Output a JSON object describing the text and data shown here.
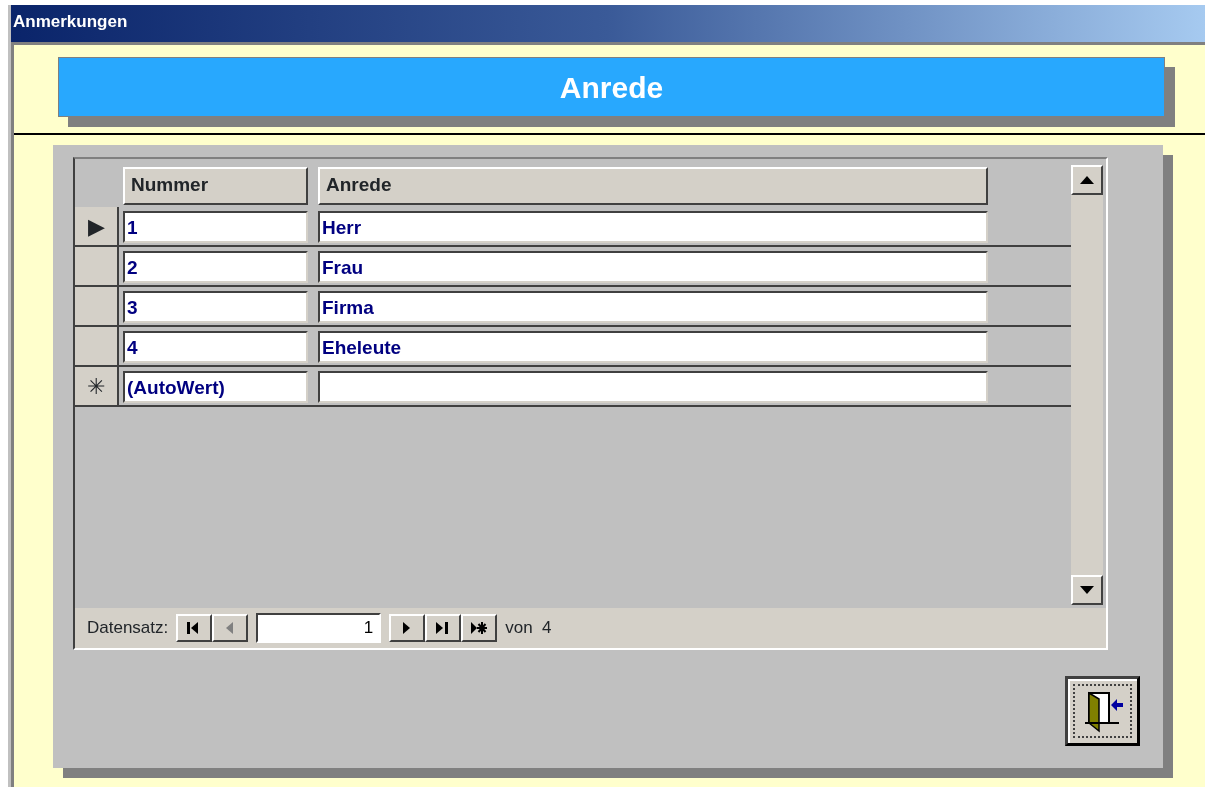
{
  "window": {
    "title": "Anmerkungen"
  },
  "header": {
    "title": "Anrede"
  },
  "table": {
    "columns": [
      "Nummer",
      "Anrede"
    ],
    "rows": [
      {
        "selector": "▶",
        "cells": [
          "1",
          "Herr"
        ]
      },
      {
        "cells": [
          "2",
          "Frau"
        ]
      },
      {
        "cells": [
          "3",
          "Firma"
        ]
      },
      {
        "cells": [
          "4",
          "Eheleute"
        ]
      },
      {
        "selector": "✳",
        "cells": [
          "(AutoWert)"
        ]
      }
    ]
  },
  "navigation": {
    "label": "Datensatz:",
    "record": "1",
    "total": "von  4",
    "buttons": [
      {
        "kind": "first",
        "disabled": false
      },
      {
        "kind": "previous",
        "disabled": true
      }
    ],
    "buttons_after": [
      {
        "kind": "next",
        "disabled": false
      },
      {
        "kind": "last",
        "disabled": false
      },
      {
        "kind": "new",
        "disabled": false
      }
    ]
  },
  "exit_button": {
    "kind": "exit"
  }
}
